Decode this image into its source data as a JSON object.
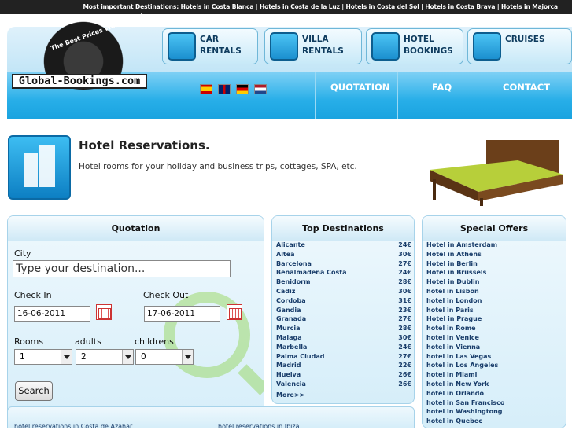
{
  "top_bar": {
    "text": "Most important Destinations: Hotels in Costa Blanca | Hotels in Costa de la Luz | Hotels in Costa del Sol | Hotels in Costa Brava | Hotels in Majorca"
  },
  "logo": {
    "arc_text": "The Best Prices WorldWide!",
    "text": "Global-Bookings.com"
  },
  "services": [
    {
      "label": "CAR\nRENTALS",
      "icon": "car-icon"
    },
    {
      "label": "VILLA\nRENTALS",
      "icon": "villa-icon"
    },
    {
      "label": "HOTEL\nBOOKINGS",
      "icon": "hotel-icon"
    },
    {
      "label": "CRUISES",
      "icon": "ship-icon"
    }
  ],
  "flags": [
    "spanish-flag-icon",
    "uk-flag-icon",
    "german-flag-icon",
    "dutch-flag-icon"
  ],
  "nav": {
    "quotation": "QUOTATION",
    "faq": "FAQ",
    "contact": "CONTACT"
  },
  "page": {
    "title": "Hotel Reservations.",
    "description": "Hotel rooms for your holiday and business trips, cottages, SPA, etc."
  },
  "quotation": {
    "title": "Quotation",
    "city_label": "City",
    "city_placeholder": "Type your destination...",
    "checkin_label": "Check In",
    "checkin_value": "16-06-2011",
    "checkout_label": "Check Out",
    "checkout_value": "17-06-2011",
    "rooms_label": "Rooms",
    "adults_label": "adults",
    "children_label": "childrens",
    "rooms_value": "1",
    "adults_value": "2",
    "children_value": "0",
    "search_label": "Search"
  },
  "top_destinations": {
    "title": "Top Destinations",
    "items": [
      {
        "name": "Alicante",
        "price": "24€"
      },
      {
        "name": "Altea",
        "price": "30€"
      },
      {
        "name": "Barcelona",
        "price": "27€"
      },
      {
        "name": "Benalmadena Costa",
        "price": "24€"
      },
      {
        "name": "Benidorm",
        "price": "28€"
      },
      {
        "name": "Cadiz",
        "price": "30€"
      },
      {
        "name": "Cordoba",
        "price": "31€"
      },
      {
        "name": "Gandia",
        "price": "23€"
      },
      {
        "name": "Granada",
        "price": "27€"
      },
      {
        "name": "Murcia",
        "price": "28€"
      },
      {
        "name": "Malaga",
        "price": "30€"
      },
      {
        "name": "Marbella",
        "price": "24€"
      },
      {
        "name": "Palma Ciudad",
        "price": "27€"
      },
      {
        "name": "Madrid",
        "price": "22€"
      },
      {
        "name": "Huelva",
        "price": "26€"
      },
      {
        "name": "Valencia",
        "price": "26€"
      }
    ],
    "more": "More>>"
  },
  "special_offers": {
    "title": "Special Offers",
    "items": [
      "Hotel in Amsterdam",
      "Hotel in Athens",
      "Hotel in Berlin",
      "Hotel in Brussels",
      "Hotel in Dublin",
      "hotel in Lisbon",
      "hotel in London",
      "hotel in Paris",
      "Hotel in Prague",
      "hotel in Rome",
      "hotel in Venice",
      "hotel in Vienna",
      "hotel in Las Vegas",
      "hotel in Los Angeles",
      "hotel in Miami",
      "hotel in New York",
      "hotel in Orlando",
      "hotel in San Francisco",
      "hotel in Washingtong",
      "hotel in Quebec"
    ]
  },
  "bottom_links": [
    "hotel reservations in Costa de Azahar",
    "hotel reservations in Ibiza"
  ]
}
